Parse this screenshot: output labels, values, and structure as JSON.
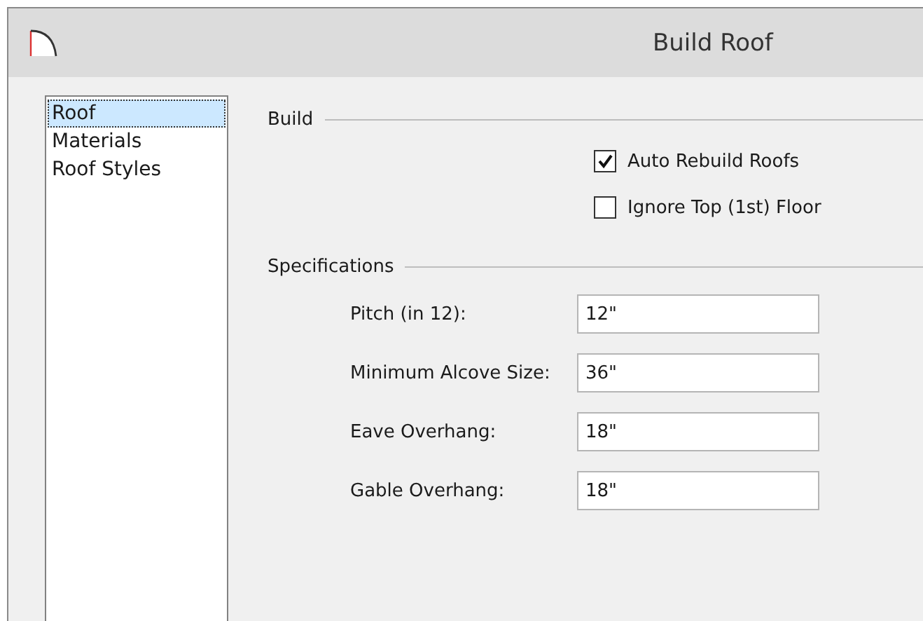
{
  "window": {
    "title": "Build Roof"
  },
  "sidebar": {
    "items": [
      {
        "label": "Roof",
        "selected": true
      },
      {
        "label": "Materials",
        "selected": false
      },
      {
        "label": "Roof Styles",
        "selected": false
      }
    ]
  },
  "build": {
    "title": "Build",
    "options": [
      {
        "label": "Auto Rebuild Roofs",
        "checked": true
      },
      {
        "label": "Ignore Top (1st) Floor",
        "checked": false
      }
    ]
  },
  "specifications": {
    "title": "Specifications",
    "fields": [
      {
        "label": "Pitch (in 12):",
        "value": "12\""
      },
      {
        "label": "Minimum Alcove Size:",
        "value": "36\""
      },
      {
        "label": "Eave Overhang:",
        "value": "18\""
      },
      {
        "label": "Gable Overhang:",
        "value": "18\""
      }
    ]
  }
}
